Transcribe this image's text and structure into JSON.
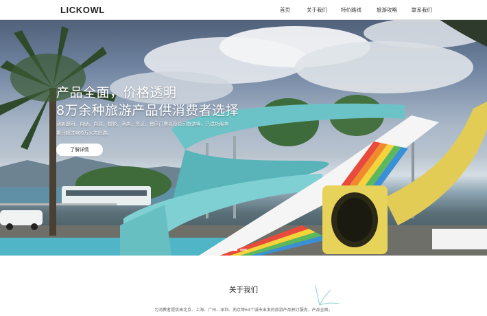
{
  "brand": {
    "logo": "LICKOWL"
  },
  "nav": {
    "items": [
      {
        "label": "首页"
      },
      {
        "label": "关于我们"
      },
      {
        "label": "特价路线"
      },
      {
        "label": "旅游攻略"
      },
      {
        "label": "联系我们"
      }
    ]
  },
  "hero": {
    "title_line1": "产品全面，价格透明",
    "title_line2": "8万余种旅游产品供消费者选择",
    "desc_line1": "涵盖跟团、自助、自驾、邮轮、酒店、签证、景区门票以及公司旅游等，已成功服务",
    "desc_line2": "累计超过400万人次出游。",
    "button_label": "了解详情",
    "slides": {
      "count": 2,
      "active_index": 0
    }
  },
  "about": {
    "title": "关于我们",
    "description": "为消费者提供由北京、上海、广州、深圳、南京等64个城市出发的旅游产品预订服务，产品全面，"
  },
  "colors": {
    "header_bg": "#ffffff",
    "button_bg": "#ffffff",
    "hero_text": "#ffffff",
    "slide_pool": "#7fc4c8",
    "slide_yellow": "#e3cc56",
    "slide_rainbow": [
      "#e84a3c",
      "#f08a2c",
      "#f5d33a",
      "#5cb85c",
      "#3a8fd6",
      "#7b57c2"
    ]
  },
  "icons": [
    "bird-doodle-icon"
  ]
}
